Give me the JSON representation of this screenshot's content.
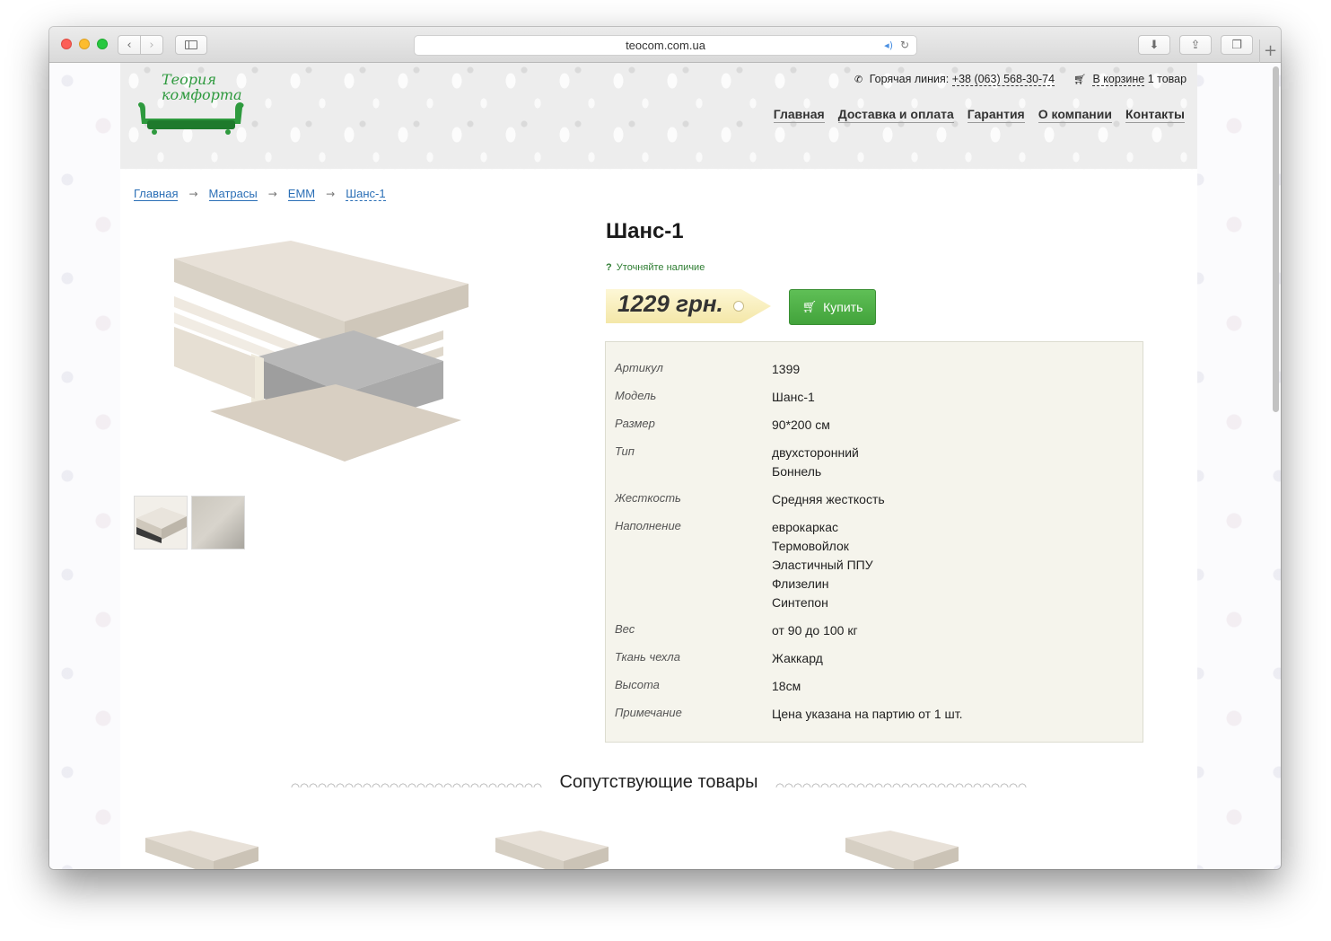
{
  "browser": {
    "url": "teocom.com.ua"
  },
  "logo": {
    "line1": "Теория",
    "line2": "комфорта"
  },
  "header": {
    "hotline_label": "Горячая линия:",
    "hotline_phone": "+38 (063) 568-30-74",
    "cart_link": "В корзине",
    "cart_count": "1 товар"
  },
  "nav": {
    "items": [
      "Главная",
      "Доставка и оплата",
      "Гарантия",
      "О компании",
      "Контакты"
    ]
  },
  "breadcrumb": {
    "items": [
      "Главная",
      "Матрасы",
      "ЕММ"
    ],
    "current": "Шанс-1",
    "separator": "→"
  },
  "product": {
    "title": "Шанс-1",
    "availability": "Уточняйте наличие",
    "availability_icon": "?",
    "price": "1229 грн.",
    "buy_label": "Купить",
    "specs": [
      {
        "label": "Артикул",
        "values": [
          "1399"
        ]
      },
      {
        "label": "Модель",
        "values": [
          "Шанс-1"
        ]
      },
      {
        "label": "Размер",
        "values": [
          "90*200 см"
        ]
      },
      {
        "label": "Тип",
        "values": [
          "двухсторонний",
          "Боннель"
        ]
      },
      {
        "label": "Жесткость",
        "values": [
          "Средняя жесткость"
        ]
      },
      {
        "label": "Наполнение",
        "values": [
          "еврокаркас",
          "Термовойлок",
          "Эластичный ППУ",
          "Флизелин",
          "Синтепон"
        ]
      },
      {
        "label": "Вес",
        "values": [
          "от 90 до 100 кг"
        ]
      },
      {
        "label": "Ткань чехла",
        "values": [
          "Жаккард"
        ]
      },
      {
        "label": "Высота",
        "values": [
          "18см"
        ]
      },
      {
        "label": "Примечание",
        "values": [
          "Цена указана на партию от 1 шт."
        ]
      }
    ]
  },
  "related": {
    "title": "Сопутствующие товары"
  },
  "colors": {
    "accent_green": "#42a33b",
    "link_blue": "#2b6fb6",
    "price_tag": "#f4e7a8",
    "spec_bg": "#f5f4ec"
  },
  "icons": {
    "phone": "phone-icon",
    "cart": "cart-icon",
    "buy": "cart-icon"
  }
}
